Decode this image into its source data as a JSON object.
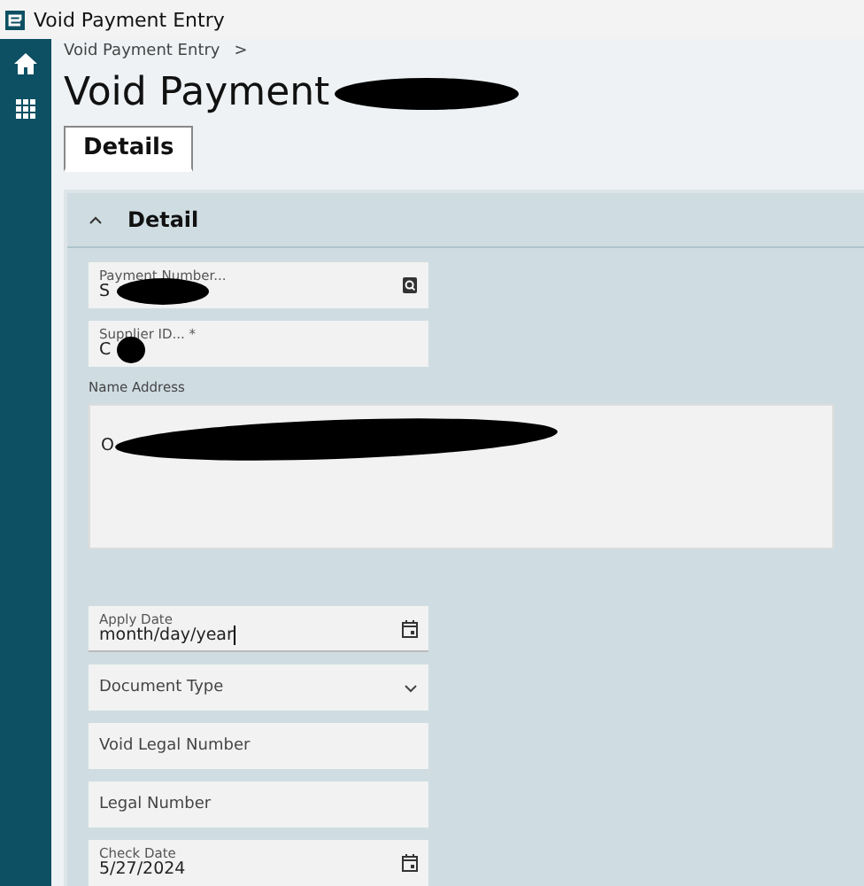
{
  "window": {
    "title": "Void Payment Entry"
  },
  "breadcrumb": [
    {
      "label": "Void Payment Entry",
      "separator": ">"
    }
  ],
  "page_title": {
    "text": "Void Payment",
    "redacted": true
  },
  "tabs": [
    {
      "label": "Details",
      "selected": true
    }
  ],
  "section": {
    "title": "Detail",
    "expanded": true
  },
  "fields": [
    {
      "kind": "lookup",
      "label": "Payment Number...",
      "value": "S",
      "redacted": true
    },
    {
      "kind": "text",
      "label": "Supplier ID... *",
      "value": "C",
      "redacted": true
    },
    {
      "kind": "textarea",
      "label": "Name Address",
      "value": "O",
      "redacted": true
    },
    {
      "kind": "date",
      "label": "Apply Date",
      "value": "month/day/year",
      "focused": true
    },
    {
      "kind": "select",
      "placeholder": "Document Type"
    },
    {
      "kind": "text",
      "placeholder": "Void Legal Number"
    },
    {
      "kind": "text",
      "placeholder": "Legal Number"
    },
    {
      "kind": "date",
      "label": "Check Date",
      "value": "5/27/2024"
    }
  ]
}
